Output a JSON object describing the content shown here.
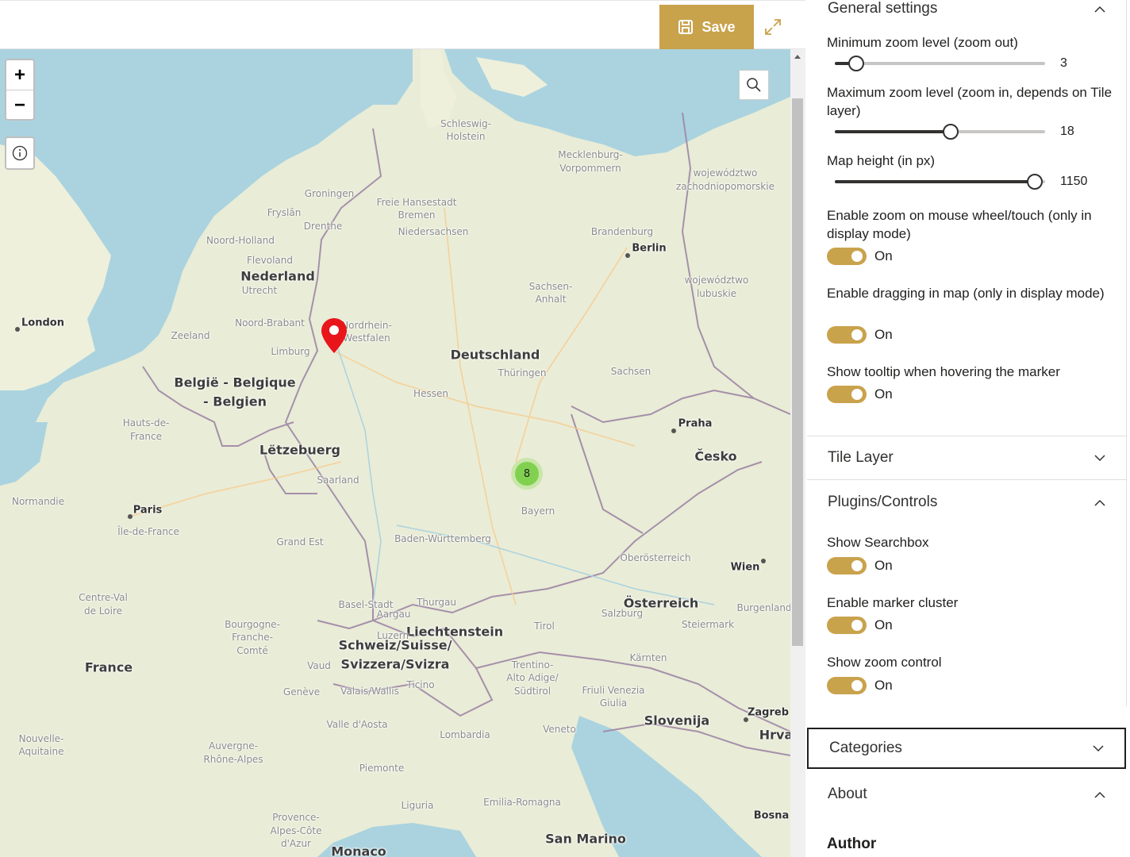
{
  "toolbar": {
    "save_label": "Save"
  },
  "map": {
    "zoom_in": "+",
    "zoom_out": "−",
    "cluster_count": "8",
    "countries": [
      "Deutschland",
      "Nederland",
      "België - Belgique",
      "- Belgien",
      "Lëtzebuerg",
      "France",
      "Česko",
      "Österreich",
      "Liechtenstein",
      "Schweiz/Suisse/",
      "Svizzera/Svizra",
      "Slovenija",
      "Hrva",
      "San Marino",
      "Monaco"
    ],
    "cities": [
      "London",
      "Paris",
      "Berlin",
      "Praha",
      "Wien",
      "Zagreb",
      "Bosna"
    ],
    "regions": [
      "Schleswig-",
      "Holstein",
      "Mecklenburg-",
      "Vorpommern",
      "Freie Hansestadt",
      "Bremen",
      "Niedersachsen",
      "Brandenburg",
      "Sachsen-",
      "Anhalt",
      "Sachsen",
      "Thüringen",
      "Hessen",
      "Nordrhein-",
      "Westfalen",
      "Bayern",
      "Baden-Württemberg",
      "Saarland",
      "Groningen",
      "Fryslân",
      "Drenthe",
      "Noord-Holland",
      "Flevoland",
      "Utrecht",
      "Noord-Brabant",
      "Zeeland",
      "Limburg",
      "Hauts-de-",
      "France",
      "Normandie",
      "Île-de-France",
      "Grand Est",
      "Centre-Val",
      "de Loire",
      "Bourgogne-",
      "Franche-",
      "Comté",
      "Nouvelle-",
      "Aquitaine",
      "Auvergne-",
      "Rhône-Alpes",
      "Provence-",
      "Alpes-Côte",
      "d'Azur",
      "Oberösterreich",
      "Salzburg",
      "Tirol",
      "Steiermark",
      "Kärnten",
      "Burgenland",
      "Basel-Stadt",
      "Aargau",
      "Thurgau",
      "Luzern",
      "Vaud",
      "Genève",
      "Valais/Wallis",
      "Ticino",
      "Valle d'Aosta",
      "Trentino-",
      "Alto Adige/",
      "Südtirol",
      "Friuli Venezia",
      "Giulia",
      "Veneto",
      "Lombardia",
      "Piemonte",
      "Liguria",
      "Emilia-Romagna",
      "województwo",
      "zachodniopomorskie",
      "województwo",
      "lubuskie"
    ]
  },
  "panel": {
    "general": {
      "title": "General settings",
      "min_zoom_label": "Minimum zoom level (zoom out)",
      "min_zoom_value": "3",
      "min_zoom_fraction": 0.1,
      "max_zoom_label": "Maximum zoom level (zoom in, depends on Tile layer)",
      "max_zoom_value": "18",
      "max_zoom_fraction": 0.55,
      "height_label": "Map height (in px)",
      "height_value": "1150",
      "height_fraction": 0.95,
      "wheel_label": "Enable zoom on mouse wheel/touch (only in display mode)",
      "wheel_state": "On",
      "drag_label": "Enable dragging in map (only in display mode)",
      "drag_state": "On",
      "tooltip_label": "Show tooltip when hovering the marker",
      "tooltip_state": "On"
    },
    "tile_layer": {
      "title": "Tile Layer"
    },
    "plugins": {
      "title": "Plugins/Controls",
      "searchbox_label": "Show Searchbox",
      "searchbox_state": "On",
      "cluster_label": "Enable marker cluster",
      "cluster_state": "On",
      "zoomctl_label": "Show zoom control",
      "zoomctl_state": "On"
    },
    "categories": {
      "title": "Categories"
    },
    "about": {
      "title": "About",
      "author_label": "Author"
    }
  },
  "colors": {
    "accent": "#c9a24c",
    "sea": "#aad3df",
    "land": "#e9ecd6",
    "border": "#9e86a6"
  }
}
